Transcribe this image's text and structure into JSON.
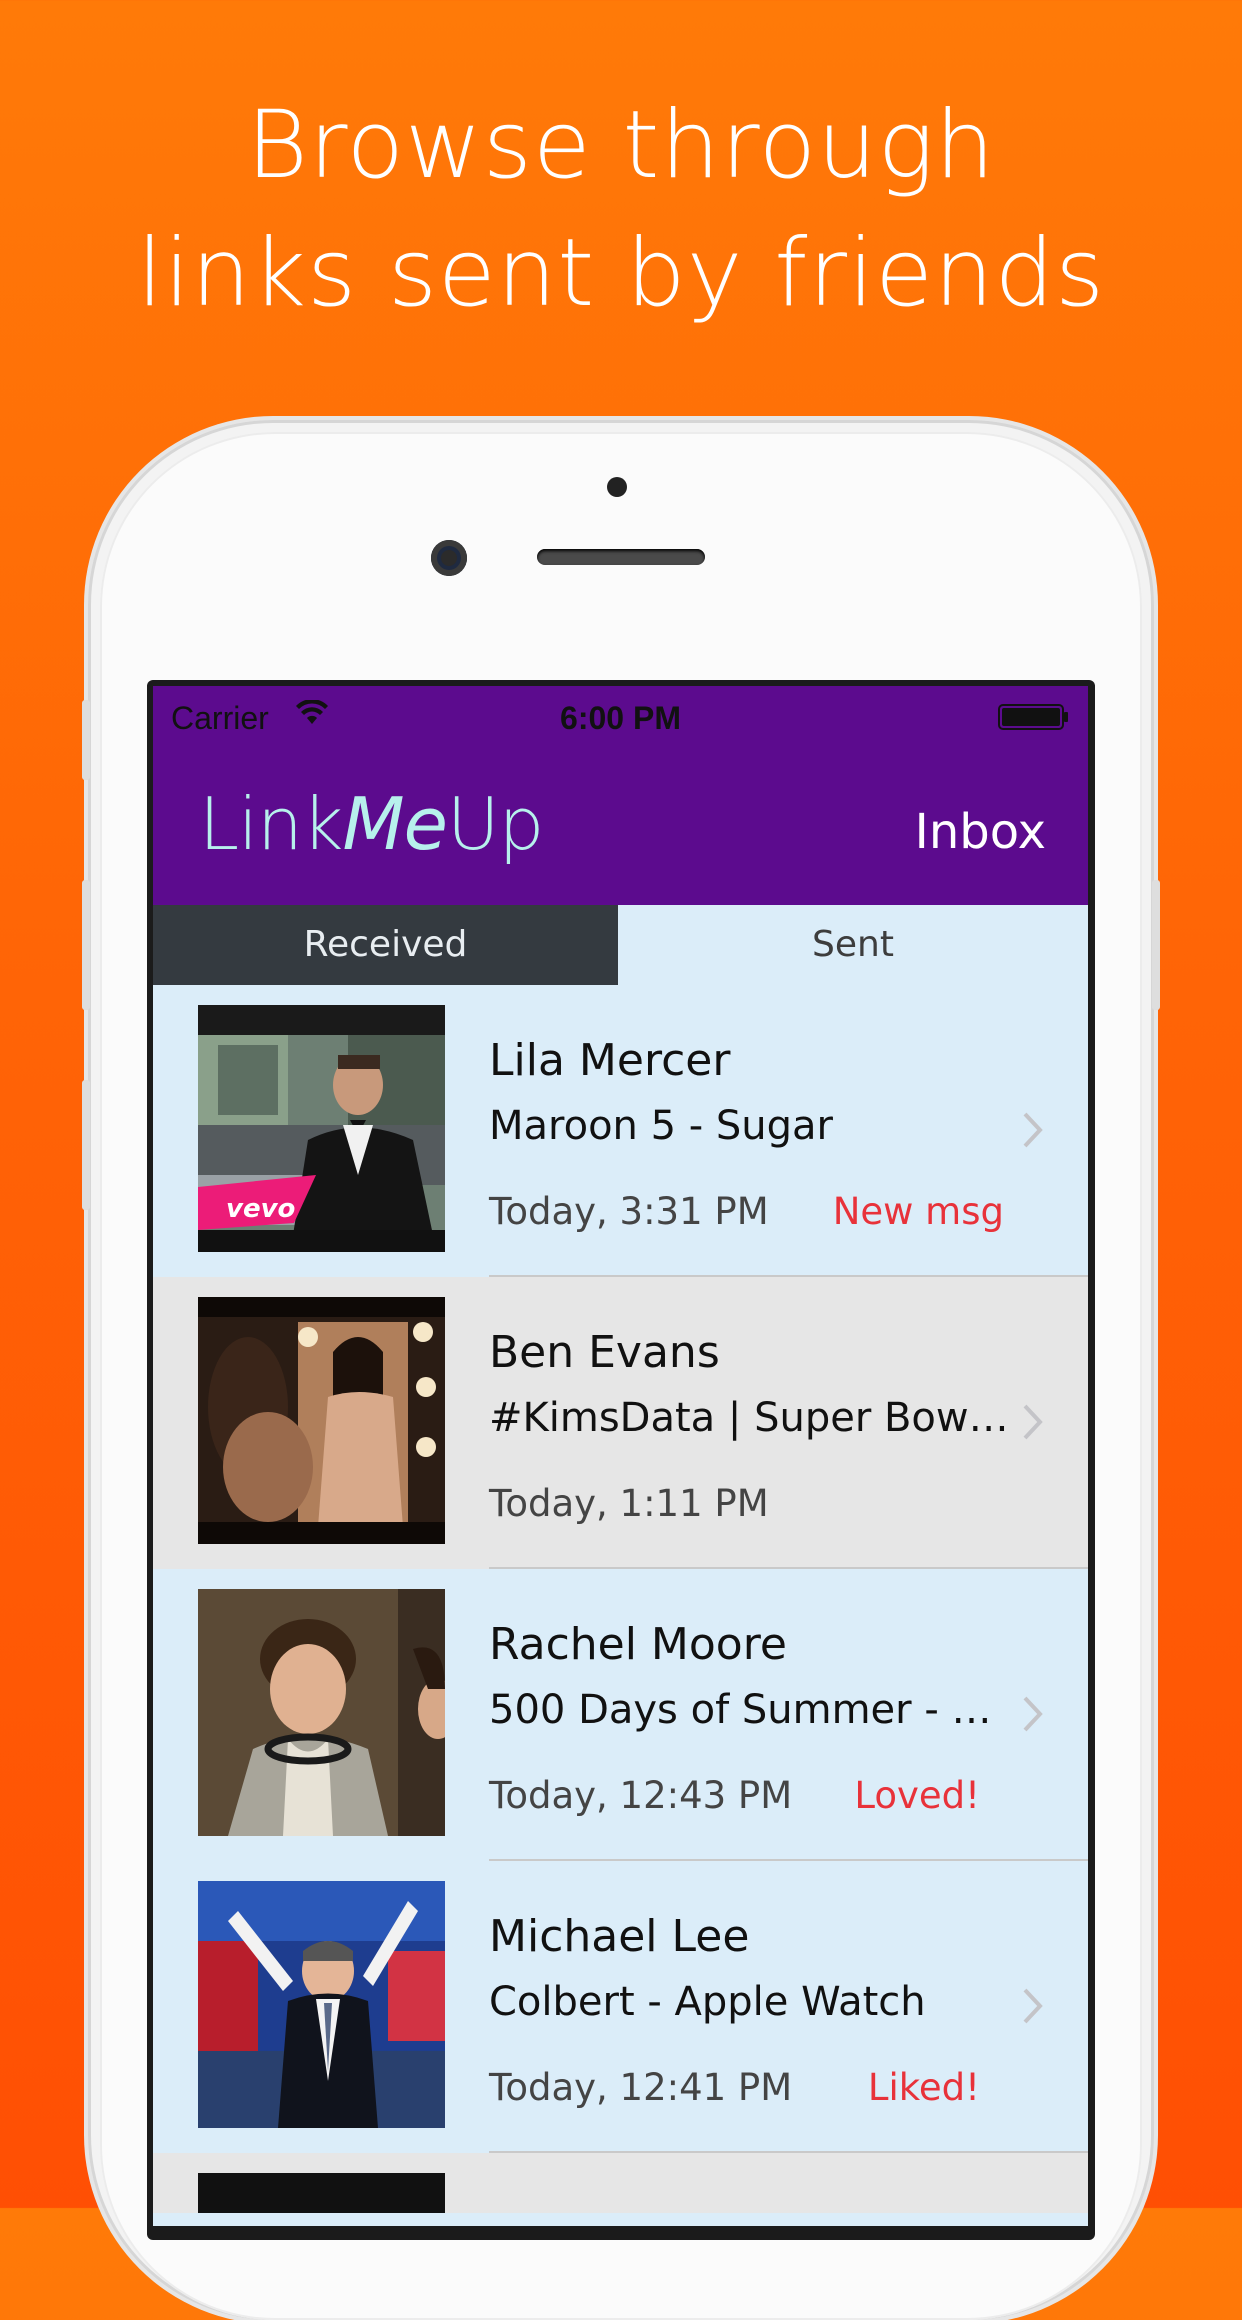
{
  "headline": {
    "line1": "Browse through",
    "line2": "links sent by friends"
  },
  "statusbar": {
    "carrier": "Carrier",
    "time": "6:00 PM",
    "wifi_icon": "wifi-icon",
    "battery_icon": "battery-icon"
  },
  "navbar": {
    "logo_part1": "Link",
    "logo_part2": "Me",
    "logo_part3": "Up",
    "right_title": "Inbox"
  },
  "tabs": [
    {
      "label": "Received",
      "active": true
    },
    {
      "label": "Sent",
      "active": false
    }
  ],
  "messages": [
    {
      "sender": "Lila Mercer",
      "title": "Maroon 5 - Sugar",
      "time": "Today, 3:31 PM",
      "status": "New msg",
      "thumb_badge": "vevo"
    },
    {
      "sender": "Ben Evans",
      "title": "#KimsData | Super Bowl…",
      "time": "Today, 1:11 PM",
      "status": ""
    },
    {
      "sender": "Rachel Moore",
      "title": "500 Days of Summer - O…",
      "time": "Today, 12:43 PM",
      "status": "Loved!"
    },
    {
      "sender": "Michael Lee",
      "title": "Colbert - Apple Watch",
      "time": "Today, 12:41 PM",
      "status": "Liked!"
    }
  ],
  "colors": {
    "background": "#ff6a06",
    "navbar": "#5c0b8e",
    "logo": "#b7f1ec",
    "status_text": "#e8323a",
    "row_blue": "#dbedf9",
    "row_gray": "#e6e6e6",
    "tab_active": "#343a40"
  }
}
